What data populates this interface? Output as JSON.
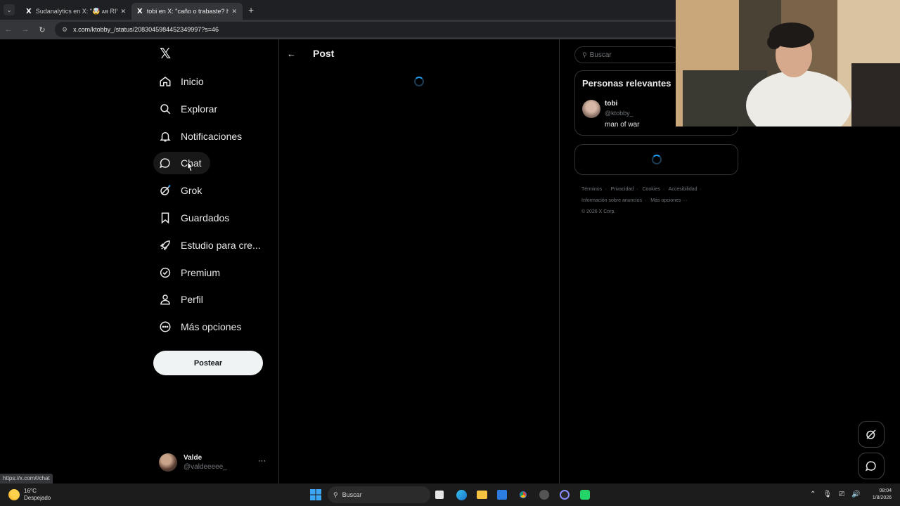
{
  "browser": {
    "tabs": [
      {
        "favicon": "X",
        "title": "Sudanalytics en X: \"🤯 ᴀʀ RIVER",
        "active": false,
        "close": "✕"
      },
      {
        "favicon": "X",
        "title": "tobi en X: \"caño o trabaste? htt",
        "active": true,
        "close": "✕"
      }
    ],
    "new_tab": "+",
    "url": "x.com/ktobby_/status/2083045984452349997?s=46",
    "status_url": "https://x.com/i/chat"
  },
  "sidebar": {
    "logo": "𝕏",
    "items": [
      {
        "label": "Inicio",
        "icon": "home-icon"
      },
      {
        "label": "Explorar",
        "icon": "search-icon"
      },
      {
        "label": "Notificaciones",
        "icon": "bell-icon"
      },
      {
        "label": "Chat",
        "icon": "chat-bubble-icon"
      },
      {
        "label": "Grok",
        "icon": "grok-icon"
      },
      {
        "label": "Guardados",
        "icon": "bookmark-icon"
      },
      {
        "label": "Estudio para cre...",
        "icon": "rocket-icon"
      },
      {
        "label": "Premium",
        "icon": "verified-badge-icon"
      },
      {
        "label": "Perfil",
        "icon": "person-icon"
      },
      {
        "label": "Más opciones",
        "icon": "more-circle-icon"
      }
    ],
    "post_button": "Postear",
    "account": {
      "name": "Valde",
      "handle": "@valdeeeee_",
      "more": "···"
    }
  },
  "main": {
    "back": "←",
    "title": "Post"
  },
  "right": {
    "search_placeholder": "Buscar",
    "relevant": {
      "title": "Personas relevantes",
      "name": "tobi",
      "handle": "@ktobby_",
      "bio": "man of war"
    },
    "footer": {
      "links": [
        "Términos",
        "Privacidad",
        "Cookies",
        "Accesibilidad",
        "Información sobre anuncios",
        "Más opciones ···"
      ],
      "separator": "·",
      "copyright": "© 2026 X Corp."
    }
  },
  "taskbar": {
    "weather_temp": "16°C",
    "weather_desc": "Despejado",
    "search_label": "Buscar",
    "time": "08:04",
    "date": "1/8/2026"
  }
}
